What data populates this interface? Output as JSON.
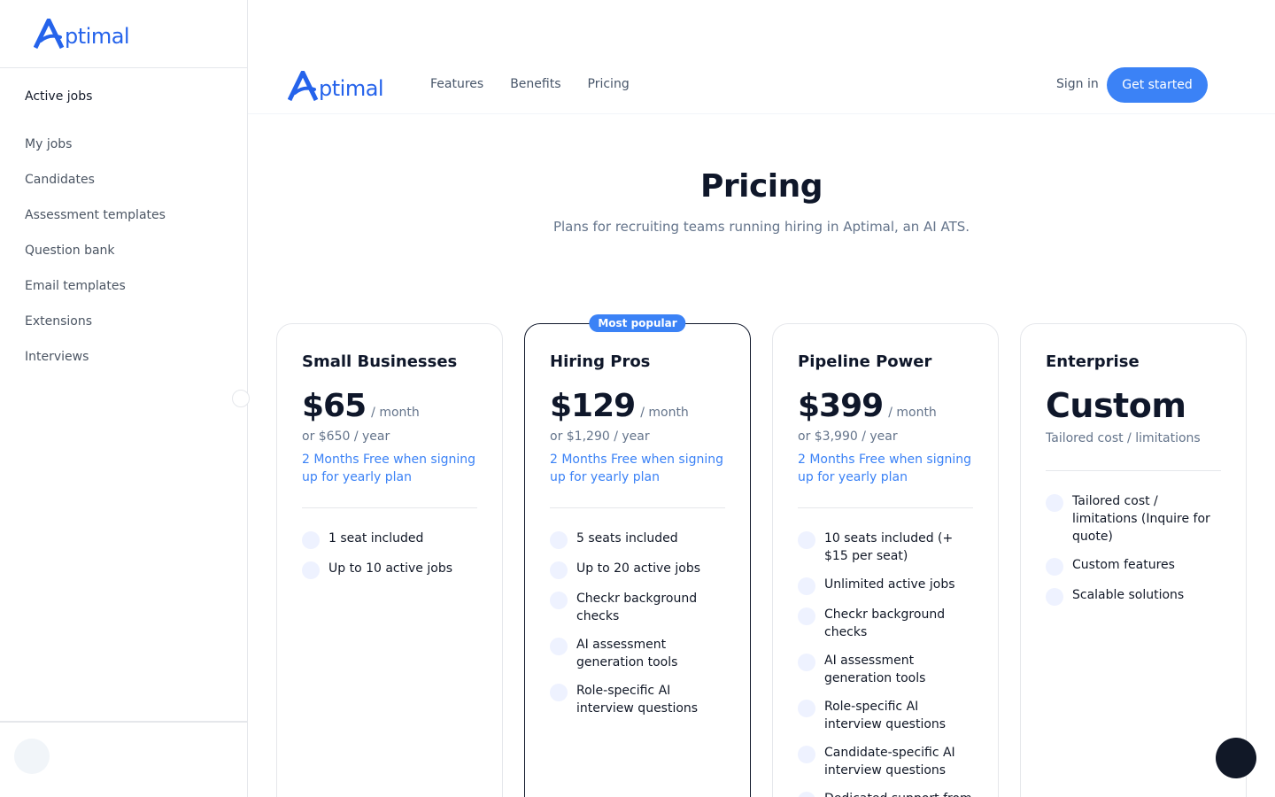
{
  "brand": {
    "name": "ptimal",
    "accent": "#3b82f6"
  },
  "sidebar": {
    "active_section": "Active jobs",
    "items": [
      {
        "label": "My jobs"
      },
      {
        "label": "Candidates"
      },
      {
        "label": "Assessment templates"
      },
      {
        "label": "Question bank"
      },
      {
        "label": "Email templates"
      },
      {
        "label": "Extensions"
      },
      {
        "label": "Interviews"
      }
    ]
  },
  "topnav": {
    "links": [
      {
        "label": "Features"
      },
      {
        "label": "Benefits"
      },
      {
        "label": "Pricing"
      }
    ],
    "signin_label": "Sign in",
    "cta_label": "Get started"
  },
  "hero": {
    "title": "Pricing",
    "subtitle": "Plans for recruiting teams running hiring in Aptimal, an AI ATS."
  },
  "plans": [
    {
      "name": "Small Businesses",
      "price": "$65",
      "period": "/ month",
      "yearly": "or $650 / year",
      "promo": "2 Months Free when signing up for yearly plan",
      "features": [
        "1 seat included",
        "Up to 10 active jobs"
      ]
    },
    {
      "name": "Hiring Pros",
      "badge": "Most popular",
      "price": "$129",
      "period": "/ month",
      "yearly": "or $1,290 / year",
      "promo": "2 Months Free when signing up for yearly plan",
      "features": [
        "5 seats included",
        "Up to 20 active jobs",
        "Checkr background checks",
        "AI assessment generation tools",
        "Role-specific AI interview questions"
      ]
    },
    {
      "name": "Pipeline Power",
      "price": "$399",
      "period": "/ month",
      "yearly": "or $3,990 / year",
      "promo": "2 Months Free when signing up for yearly plan",
      "features": [
        "10 seats included (+ $15 per seat)",
        "Unlimited active jobs",
        "Checkr background checks",
        "AI assessment generation tools",
        "Role-specific AI interview questions",
        "Candidate-specific AI interview questions",
        "Dedicated support from"
      ]
    },
    {
      "name": "Enterprise",
      "price": "Custom",
      "subtitle": "Tailored cost / limitations",
      "features": [
        "Tailored cost / limitations (Inquire for quote)",
        "Custom features",
        "Scalable solutions"
      ]
    }
  ]
}
